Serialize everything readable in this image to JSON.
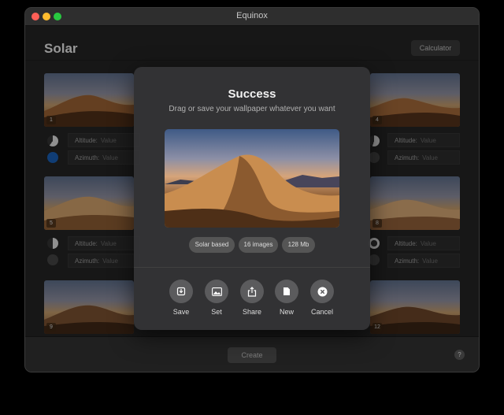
{
  "window": {
    "title": "Equinox"
  },
  "header": {
    "title": "Solar",
    "calculator_label": "Calculator"
  },
  "tiles": [
    {
      "num": "1"
    },
    {
      "num": "4"
    },
    {
      "num": "5"
    },
    {
      "num": "8"
    },
    {
      "num": "9"
    },
    {
      "num": "12"
    }
  ],
  "controls": {
    "altitude_label": "Altitude:",
    "azimuth_label": "Azimuth:",
    "value_placeholder": "Value"
  },
  "footer": {
    "create_label": "Create",
    "help_label": "?"
  },
  "modal": {
    "title": "Success",
    "subtitle": "Drag or save your wallpaper whatever you want",
    "tags": [
      "Solar based",
      "16 images",
      "128 Mb"
    ],
    "actions": [
      {
        "label": "Save",
        "icon": "save-icon"
      },
      {
        "label": "Set",
        "icon": "set-wallpaper-icon"
      },
      {
        "label": "Share",
        "icon": "share-icon"
      },
      {
        "label": "New",
        "icon": "new-document-icon"
      },
      {
        "label": "Cancel",
        "icon": "close-icon"
      }
    ]
  },
  "colors": {
    "accent_blue": "#1a5fb4",
    "traffic_close": "#fe5f57",
    "traffic_min": "#febc2e",
    "traffic_max": "#28c840"
  }
}
